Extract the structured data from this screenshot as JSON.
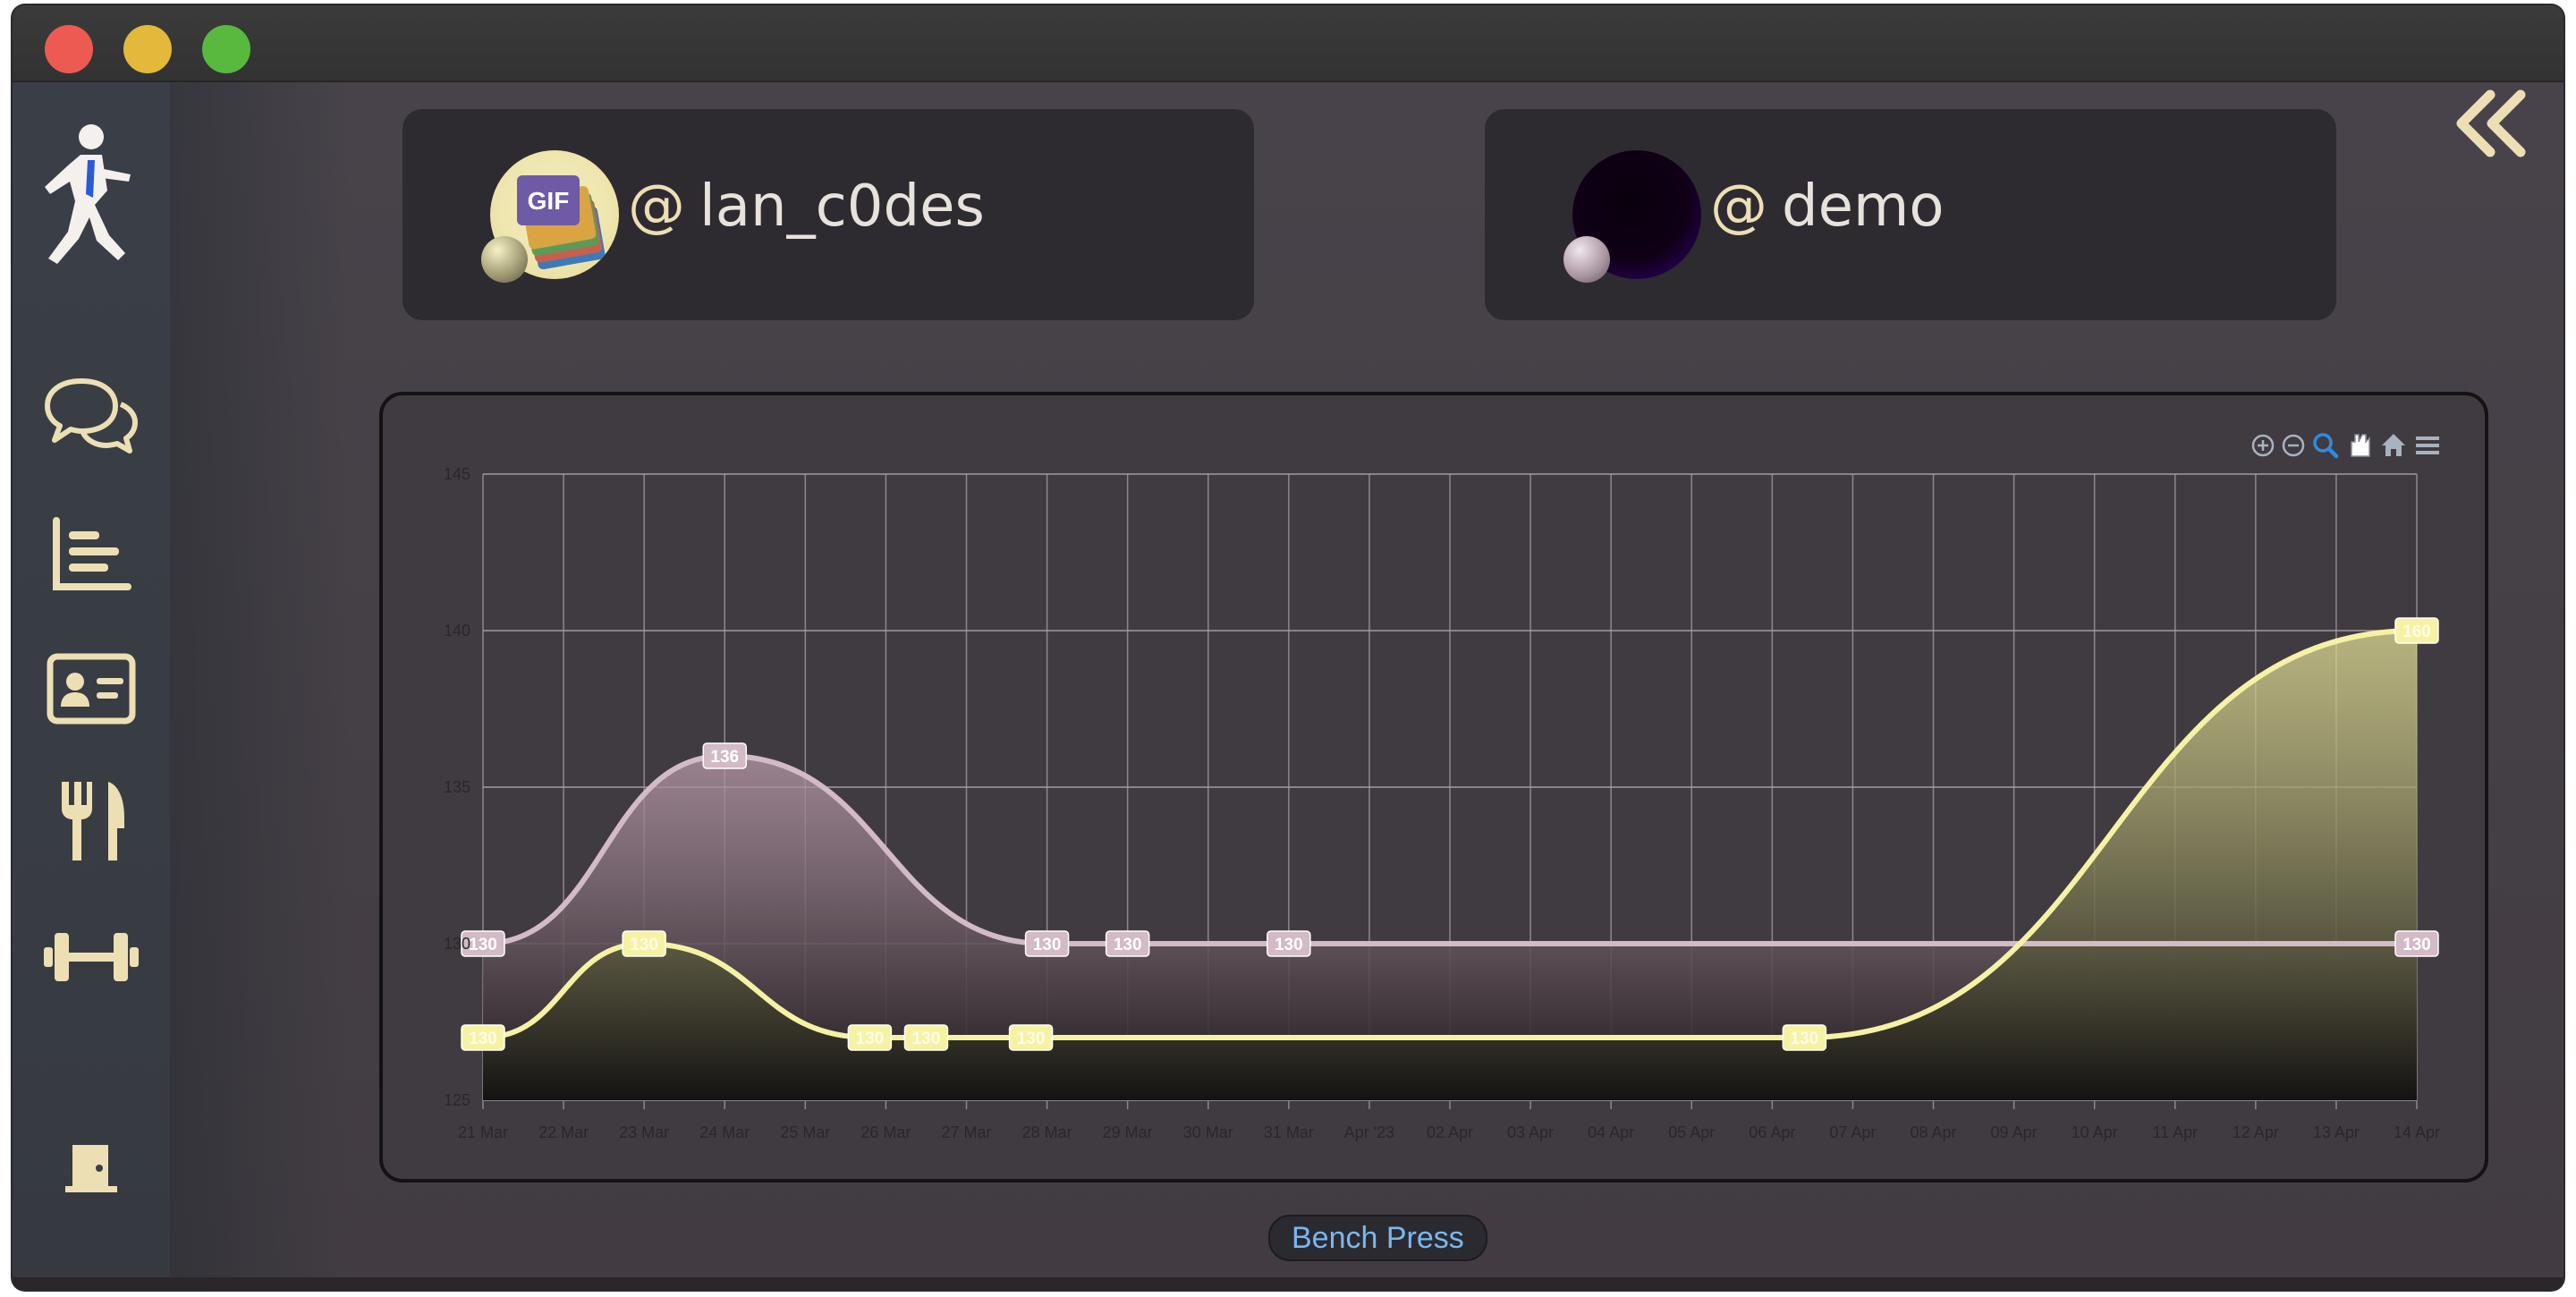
{
  "window": {
    "controls": [
      "close",
      "minimize",
      "zoom"
    ]
  },
  "sidebar": {
    "items": [
      {
        "icon": "runner-logo-icon"
      },
      {
        "icon": "chat-bubbles-icon"
      },
      {
        "icon": "bar-chart-icon"
      },
      {
        "icon": "id-card-icon"
      },
      {
        "icon": "fork-knife-icon"
      },
      {
        "icon": "dumbbell-icon"
      },
      {
        "icon": "exit-door-icon"
      }
    ]
  },
  "header": {
    "collapse_icon": "double-chevron-left-icon"
  },
  "users": [
    {
      "at": "@",
      "handle": "lan_c0des",
      "avatar": "gif-avatar",
      "series_color": "#d2bac6"
    },
    {
      "at": "@",
      "handle": "demo",
      "avatar": "dark-orb-avatar",
      "series_color": "#f6f2a4"
    }
  ],
  "chart_toolbar": [
    "zoom-in-icon",
    "zoom-out-icon",
    "zoom-select-icon",
    "pan-hand-icon",
    "home-icon",
    "menu-icon"
  ],
  "chart_data": {
    "type": "area",
    "x": [
      "21 Mar",
      "22 Mar",
      "23 Mar",
      "24 Mar",
      "25 Mar",
      "26 Mar",
      "27 Mar",
      "28 Mar",
      "29 Mar",
      "30 Mar",
      "31 Mar",
      "Apr '23",
      "02 Apr",
      "03 Apr",
      "04 Apr",
      "05 Apr",
      "06 Apr",
      "07 Apr",
      "08 Apr",
      "09 Apr",
      "10 Apr",
      "11 Apr",
      "12 Apr",
      "13 Apr",
      "14 Apr"
    ],
    "series": [
      {
        "name": "",
        "color": "#d2bac6",
        "points": [
          {
            "x": 0,
            "y": 130
          },
          {
            "x": 3,
            "y": 136
          },
          {
            "x": 7,
            "y": 130
          },
          {
            "x": 8,
            "y": 130
          },
          {
            "x": 10,
            "y": 130
          },
          {
            "x": 24,
            "y": 130
          }
        ],
        "labels": [
          "130",
          "136",
          "130",
          "130",
          "130",
          "130"
        ]
      },
      {
        "name": "",
        "color": "#f6f2a4",
        "points": [
          {
            "x": 0,
            "y": 127
          },
          {
            "x": 2,
            "y": 130
          },
          {
            "x": 4.8,
            "y": 127
          },
          {
            "x": 5.5,
            "y": 127
          },
          {
            "x": 6.8,
            "y": 127
          },
          {
            "x": 16.4,
            "y": 127
          },
          {
            "x": 24,
            "y": 140
          }
        ],
        "labels": [
          "130",
          "130",
          "130",
          "130",
          "130",
          "130",
          "160"
        ]
      }
    ],
    "ylim": [
      125,
      145
    ],
    "yticks": [
      "125",
      "130",
      "135",
      "140",
      "145"
    ],
    "grid": true
  },
  "exercise": {
    "label": "Bench Press"
  }
}
